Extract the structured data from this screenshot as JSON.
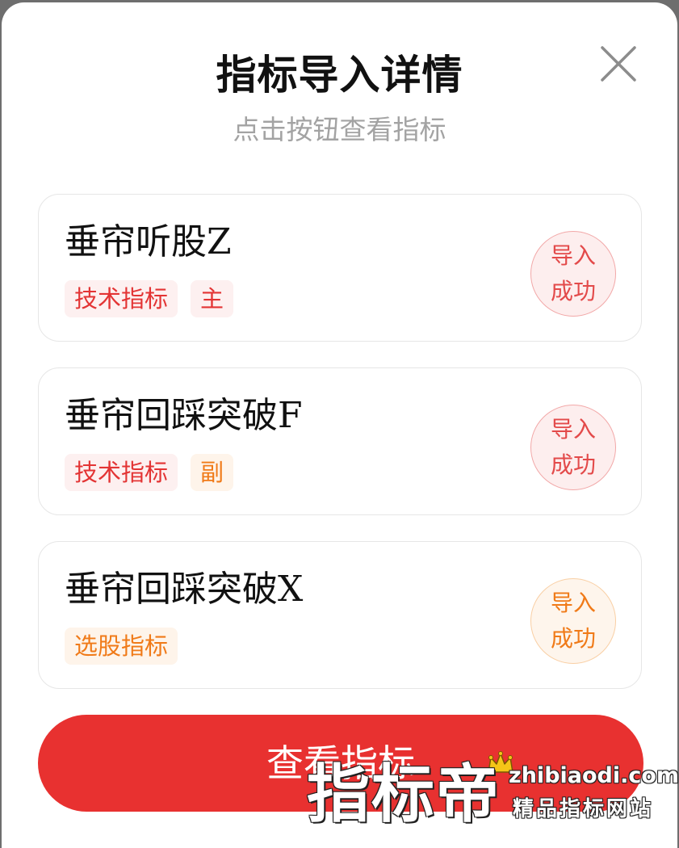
{
  "modal": {
    "title": "指标导入详情",
    "subtitle": "点击按钮查看指标",
    "close_icon": "close-icon"
  },
  "indicators": [
    {
      "name": "垂帘听股Z",
      "tags": [
        {
          "label": "技术指标",
          "color": "#e33434"
        },
        {
          "label": "主",
          "color": "#e33434"
        }
      ],
      "status_line1": "导入",
      "status_line2": "成功",
      "status_color": "#e34a4a"
    },
    {
      "name": "垂帘回踩突破F",
      "tags": [
        {
          "label": "技术指标",
          "color": "#e33434"
        },
        {
          "label": "副",
          "color": "#f07a18"
        }
      ],
      "status_line1": "导入",
      "status_line2": "成功",
      "status_color": "#e34a4a"
    },
    {
      "name": "垂帘回踩突破X",
      "tags": [
        {
          "label": "选股指标",
          "color": "#f07a18"
        }
      ],
      "status_line1": "导入",
      "status_line2": "成功",
      "status_color": "#f07a18"
    }
  ],
  "footer": {
    "view_button_label": "查看指标",
    "button_color": "#e83130"
  },
  "watermark": {
    "big_text": "指标帝",
    "domain": "zhibiaodi.com",
    "sub_text": "精品指标网站"
  }
}
